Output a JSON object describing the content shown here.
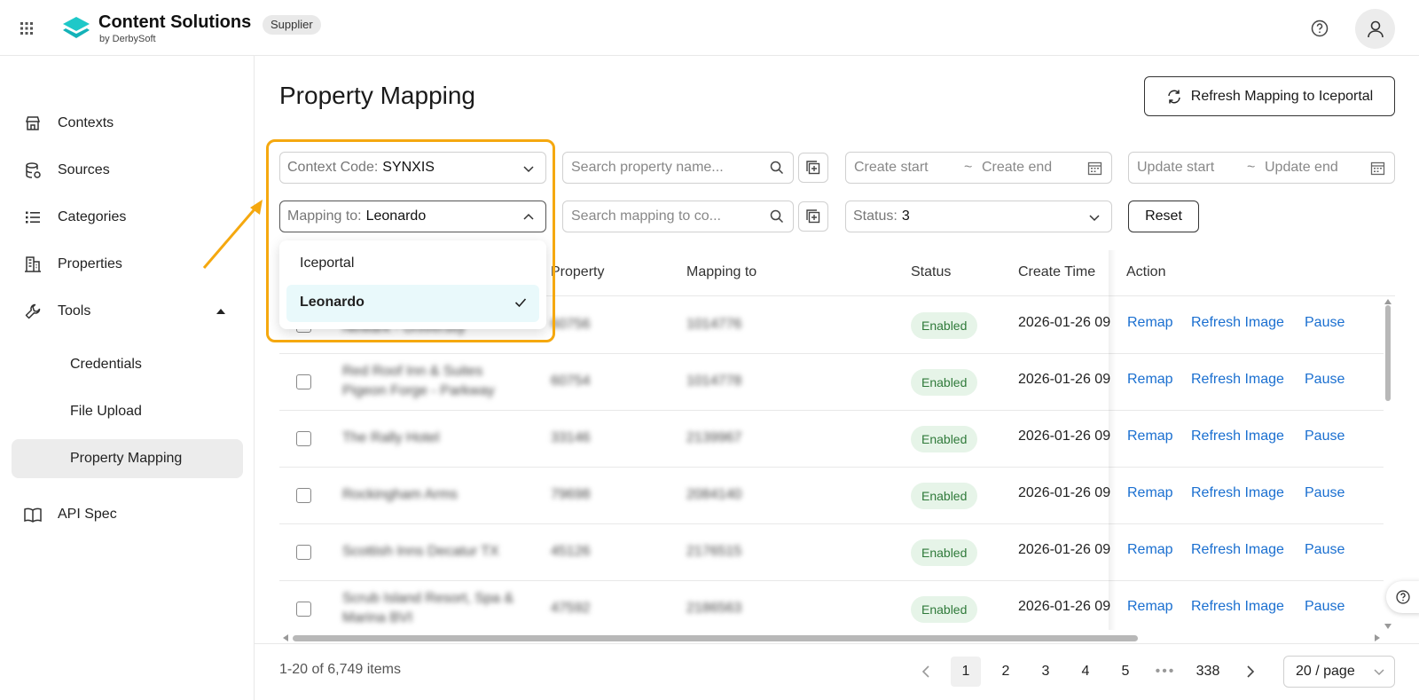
{
  "app": {
    "brand_title": "Content Solutions",
    "brand_subtitle": "by DerbySoft",
    "role_badge": "Supplier",
    "icons": {
      "apps": "grid-icon",
      "help": "help-circle-icon",
      "user": "user-icon",
      "logo": "content-solutions-logo"
    }
  },
  "sidebar": {
    "items": [
      {
        "label": "Contexts",
        "icon": "store-icon"
      },
      {
        "label": "Sources",
        "icon": "database-icon"
      },
      {
        "label": "Categories",
        "icon": "list-icon"
      },
      {
        "label": "Properties",
        "icon": "building-icon"
      },
      {
        "label": "Tools",
        "icon": "wrench-icon",
        "expanded": true
      },
      {
        "label": "API Spec",
        "icon": "book-icon"
      }
    ],
    "tools_children": [
      {
        "label": "Credentials",
        "active": false
      },
      {
        "label": "File Upload",
        "active": false
      },
      {
        "label": "Property Mapping",
        "active": true
      }
    ]
  },
  "main": {
    "title": "Property Mapping",
    "refresh_button": "Refresh Mapping to Iceportal"
  },
  "filters": {
    "context_code": {
      "label": "Context Code:",
      "value": "SYNXIS"
    },
    "mapping_to": {
      "label": "Mapping to:",
      "value": "Leonardo",
      "open": true,
      "options": [
        {
          "label": "Iceportal",
          "selected": false
        },
        {
          "label": "Leonardo",
          "selected": true
        }
      ]
    },
    "search_property_placeholder": "Search property name...",
    "search_mapping_placeholder": "Search mapping to co...",
    "create_start": "Create start",
    "create_end": "Create end",
    "update_start": "Update start",
    "update_end": "Update end",
    "range_separator": "~",
    "status": {
      "label": "Status:",
      "value": "3"
    },
    "reset": "Reset"
  },
  "table": {
    "columns": [
      "Property",
      "Mapping to",
      "Status",
      "Create Time",
      "Action"
    ],
    "actions": [
      "Remap",
      "Refresh Image",
      "Pause"
    ],
    "rows": [
      {
        "name": "Newark - University",
        "property": "60756",
        "mapping": "1014776",
        "status": "Enabled",
        "create_time": "2026-01-26 09"
      },
      {
        "name": "Red Roof Inn & Suites Pigeon Forge - Parkway",
        "property": "60754",
        "mapping": "1014778",
        "status": "Enabled",
        "create_time": "2026-01-26 09"
      },
      {
        "name": "The Rally Hotel",
        "property": "33146",
        "mapping": "2139967",
        "status": "Enabled",
        "create_time": "2026-01-26 09"
      },
      {
        "name": "Rockingham Arms",
        "property": "79698",
        "mapping": "2084140",
        "status": "Enabled",
        "create_time": "2026-01-26 09"
      },
      {
        "name": "Scottish Inns Decatur TX",
        "property": "45126",
        "mapping": "2176515",
        "status": "Enabled",
        "create_time": "2026-01-26 09"
      },
      {
        "name": "Scrub Island Resort, Spa & Marina BVI",
        "property": "47592",
        "mapping": "2186563",
        "status": "Enabled",
        "create_time": "2026-01-26 09"
      }
    ]
  },
  "pagination": {
    "total_text": "1-20 of 6,749 items",
    "pages": [
      "1",
      "2",
      "3",
      "4",
      "5"
    ],
    "current": "1",
    "ellipsis": "•••",
    "last": "338",
    "page_size": "20 / page"
  },
  "colors": {
    "accent_link": "#1a6fd0",
    "highlight": "#f5a80f",
    "enabled_bg": "#e6f4e8",
    "enabled_text": "#2f7a3a",
    "logo": "#1ec8c8"
  }
}
